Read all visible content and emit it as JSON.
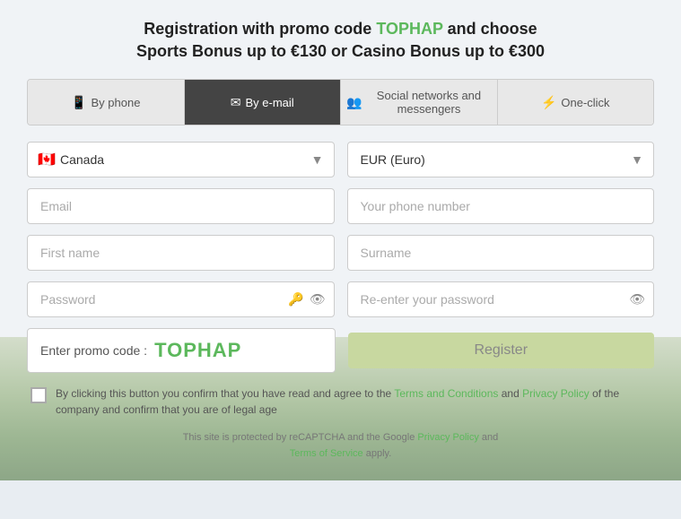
{
  "headline": {
    "prefix": "Registration with promo code ",
    "promo": "TOPHAP",
    "suffix": " and choose",
    "line2": "Sports Bonus up to €130 or Casino Bonus up to €300"
  },
  "tabs": [
    {
      "id": "phone",
      "label": "By phone",
      "icon": "📱",
      "active": false
    },
    {
      "id": "email",
      "label": "By e-mail",
      "icon": "✉",
      "active": true
    },
    {
      "id": "social",
      "label": "Social networks and messengers",
      "icon": "👥",
      "active": false
    },
    {
      "id": "oneclick",
      "label": "One-click",
      "icon": "⚡",
      "active": false
    }
  ],
  "form": {
    "country_placeholder": "Canada",
    "currency_placeholder": "EUR (Euro)",
    "email_placeholder": "Email",
    "phone_placeholder": "Your phone number",
    "firstname_placeholder": "First name",
    "surname_placeholder": "Surname",
    "password_placeholder": "Password",
    "repassword_placeholder": "Re-enter your password",
    "promo_label": "Enter promo code :",
    "promo_code": "TOPHAP",
    "register_label": "Register"
  },
  "terms": {
    "text_prefix": "By clicking this button you confirm that you have read and agree to the ",
    "terms_link": "Terms and Conditions",
    "text_middle": " and ",
    "privacy_link": "Privacy Policy",
    "text_suffix": " of the company and confirm that you are of legal age"
  },
  "recaptcha": {
    "text_prefix": "This site is protected by reCAPTCHA and the Google ",
    "privacy_link": "Privacy Policy",
    "text_middle": " and",
    "terms_link": "Terms of Service",
    "text_suffix": " apply."
  }
}
